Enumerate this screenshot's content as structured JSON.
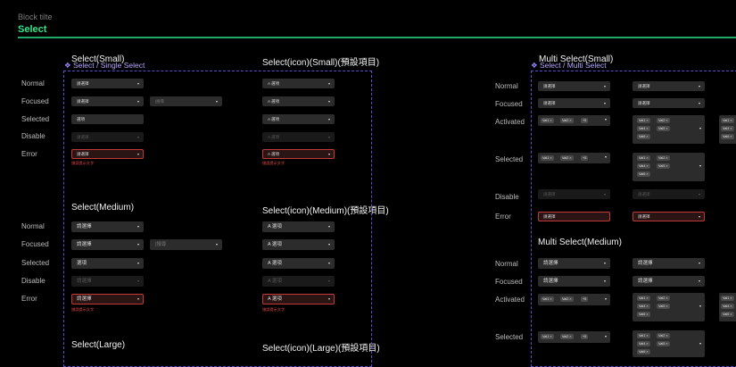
{
  "header": {
    "block_title": "Block tilte",
    "title": "Select"
  },
  "frames": {
    "left_label": "Select / Single Select",
    "right_label": "Select / Multi Select"
  },
  "states": [
    "Normal",
    "Focused",
    "Selected",
    "Disable",
    "Error"
  ],
  "multi_states": [
    "Normal",
    "Focused",
    "Activated",
    "Selected",
    "Disable",
    "Error"
  ],
  "sections": {
    "select_small": "Select(Small)",
    "select_icon_small": "Select(icon)(Small)(預設項目)",
    "select_medium": "Select(Medium)",
    "select_icon_medium": "Select(icon)(Medium)(預設項目)",
    "select_large": "Select(Large)",
    "select_icon_large": "Select(icon)(Large)(預設項目)",
    "multi_small": "Multi Select(Small)",
    "multi_medium": "Multi Select(Medium)"
  },
  "select": {
    "placeholder": "請選擇",
    "selected_value": "選項",
    "search_placeholder": "|搜尋",
    "error_hint": "錯誤提示文字",
    "icon_prefix": "A",
    "caret": "▾"
  },
  "tags": {
    "val1": "Val1 ×",
    "val2": "Val2 ×",
    "val4": "Val4 ×",
    "val5": "Val5 ×",
    "val6": "Val6 ×",
    "more": "+5"
  },
  "colors": {
    "accent": "#2ee58a",
    "frame": "#5b4fd0",
    "error": "#e04646"
  }
}
